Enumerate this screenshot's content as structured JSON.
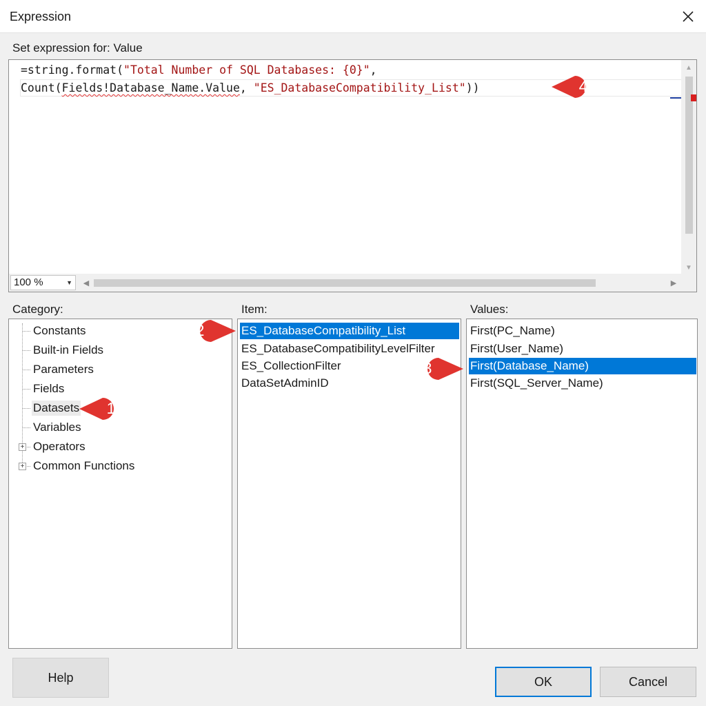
{
  "window": {
    "title": "Expression"
  },
  "editor": {
    "label": "Set expression for: Value",
    "line1_prefix": "=string.format(",
    "line1_string": "\"Total Number of SQL Databases: {0}\"",
    "line1_suffix": ",",
    "line2_fn": "Count(",
    "line2_field": "Fields!Database_Name.Value",
    "line2_sep": ", ",
    "line2_string": "\"ES_DatabaseCompatibility_List\"",
    "line2_end": "))",
    "zoom": "100 %"
  },
  "category": {
    "label": "Category:",
    "items": [
      {
        "label": "Constants",
        "expandable": false
      },
      {
        "label": "Built-in Fields",
        "expandable": false
      },
      {
        "label": "Parameters",
        "expandable": false
      },
      {
        "label": "Fields",
        "expandable": false
      },
      {
        "label": "Datasets",
        "expandable": false,
        "highlighted": true
      },
      {
        "label": "Variables",
        "expandable": false
      },
      {
        "label": "Operators",
        "expandable": true
      },
      {
        "label": "Common Functions",
        "expandable": true
      }
    ]
  },
  "item": {
    "label": "Item:",
    "items": [
      {
        "label": "ES_DatabaseCompatibility_List",
        "selected": true
      },
      {
        "label": "ES_DatabaseCompatibilityLevelFilter",
        "selected": false
      },
      {
        "label": "ES_CollectionFilter",
        "selected": false
      },
      {
        "label": "DataSetAdminID",
        "selected": false
      }
    ]
  },
  "values": {
    "label": "Values:",
    "items": [
      {
        "label": "First(PC_Name)",
        "selected": false
      },
      {
        "label": "First(User_Name)",
        "selected": false
      },
      {
        "label": "First(Database_Name)",
        "selected": true
      },
      {
        "label": "First(SQL_Server_Name)",
        "selected": false
      }
    ]
  },
  "buttons": {
    "help": "Help",
    "ok": "OK",
    "cancel": "Cancel"
  },
  "callouts": [
    "1",
    "2",
    "3",
    "4"
  ],
  "colors": {
    "selection": "#0078d7",
    "callout": "#e0342f",
    "string_literal": "#a31515"
  }
}
